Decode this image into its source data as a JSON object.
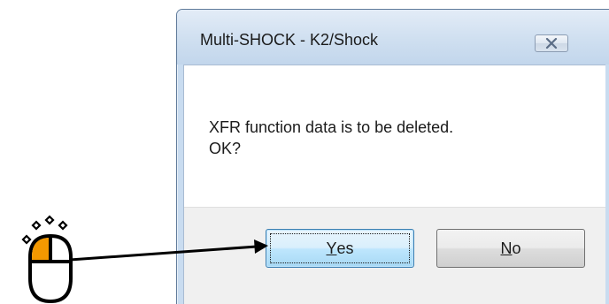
{
  "dialog": {
    "title": "Multi-SHOCK - K2/Shock",
    "message_line1": "XFR function data is to be deleted.",
    "message_line2": "OK?",
    "buttons": {
      "yes": {
        "accel": "Y",
        "rest": "es"
      },
      "no": {
        "accel": "N",
        "rest": "o"
      }
    },
    "close_icon": "close-x-icon"
  },
  "annotation": {
    "mouse_icon": "mouse-left-click-icon",
    "highlight_color": "#f39800",
    "arrow_target": "yes-button"
  }
}
